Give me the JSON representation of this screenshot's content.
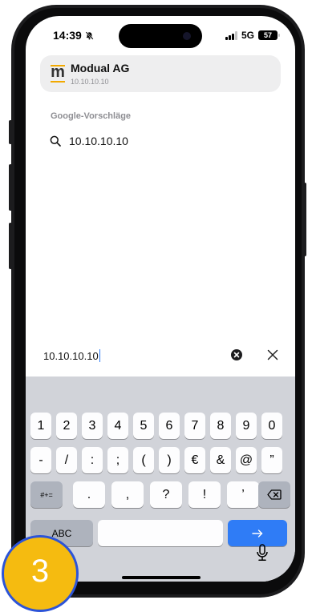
{
  "status": {
    "time": "14:39",
    "network": "5G",
    "battery": "57"
  },
  "top_result": {
    "title": "Modual AG",
    "subtitle": "10.10.10.10",
    "logo": "m"
  },
  "suggestions": {
    "label": "Google-Vorschläge",
    "items": [
      "10.10.10.10"
    ]
  },
  "address_bar": {
    "value": "10.10.10.10"
  },
  "keyboard": {
    "row1": [
      "1",
      "2",
      "3",
      "4",
      "5",
      "6",
      "7",
      "8",
      "9",
      "0"
    ],
    "row2": [
      "-",
      "/",
      ":",
      ";",
      "(",
      ")",
      "€",
      "&",
      "@",
      "”"
    ],
    "row3_left": "#+=",
    "row3": [
      ".",
      ",",
      "?",
      "!",
      "’"
    ],
    "abc": "ABC",
    "go_icon": "arrow-right-icon",
    "mic_icon": "microphone-icon",
    "delete_icon": "backspace-icon"
  },
  "badge": {
    "number": "3"
  },
  "colors": {
    "accent": "#2f7cf6",
    "badge_fill": "#f5bb10",
    "badge_border": "#2c54d8",
    "logo_accent": "#f2a900"
  }
}
